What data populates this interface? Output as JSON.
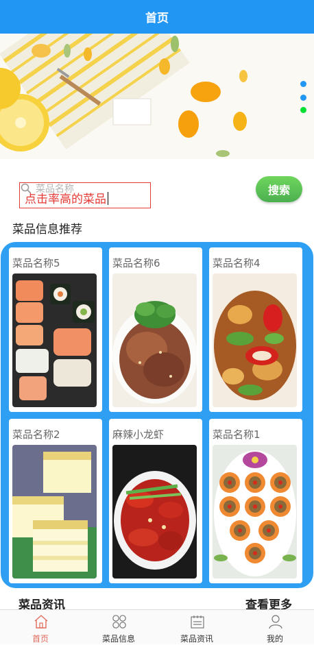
{
  "header": {
    "title": "首页"
  },
  "banner": {
    "indicator_count": 3,
    "active_index": 2,
    "colors": {
      "dot": "#2196f3",
      "dot_active": "#00e032"
    }
  },
  "search": {
    "placeholder": "菜品名称",
    "typed_hint": "点击率高的菜品",
    "button_label": "搜索"
  },
  "recommend": {
    "title": "菜品信息推荐",
    "items": [
      {
        "name": "菜品名称5",
        "image": "sushi-photo"
      },
      {
        "name": "菜品名称6",
        "image": "beef-platter-photo"
      },
      {
        "name": "菜品名称4",
        "image": "stir-fry-pepper-photo"
      },
      {
        "name": "菜品名称2",
        "image": "osmanthus-cake-photo"
      },
      {
        "name": "麻辣小龙虾",
        "image": "crayfish-photo"
      },
      {
        "name": "菜品名称1",
        "image": "tart-platter-photo"
      }
    ]
  },
  "news": {
    "title": "菜品资讯",
    "more_label": "查看更多"
  },
  "tabbar": {
    "items": [
      {
        "label": "首页",
        "icon": "home-icon",
        "active": true
      },
      {
        "label": "菜品信息",
        "icon": "grid-icon",
        "active": false
      },
      {
        "label": "菜品资讯",
        "icon": "news-icon",
        "active": false
      },
      {
        "label": "我的",
        "icon": "user-icon",
        "active": false
      }
    ]
  },
  "colors": {
    "primary": "#2196f3",
    "search_button": "#4caf50",
    "highlight": "#e53935",
    "tab_active": "#e06b5c"
  }
}
